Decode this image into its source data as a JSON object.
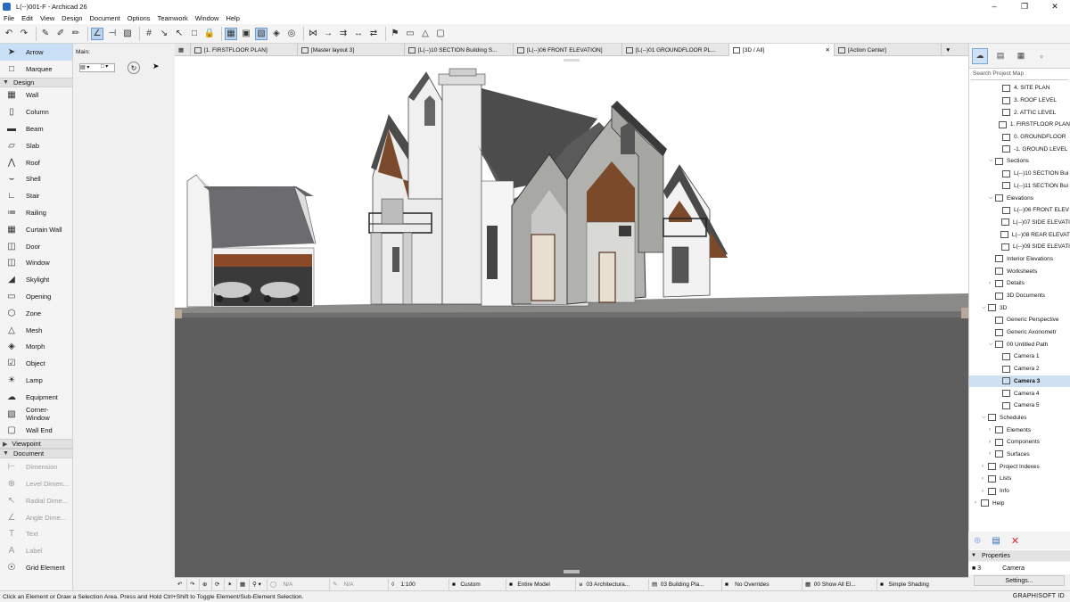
{
  "window": {
    "title": "L(--)001-F - Archicad 26"
  },
  "menu": [
    "File",
    "Edit",
    "View",
    "Design",
    "Document",
    "Options",
    "Teamwork",
    "Window",
    "Help"
  ],
  "toolbox": {
    "arrow": "Arrow",
    "marquee": "Marquee",
    "design_header": "Design",
    "design_tools": [
      "Wall",
      "Column",
      "Beam",
      "Slab",
      "Roof",
      "Shell",
      "Stair",
      "Railing",
      "Curtain Wall",
      "Door",
      "Window",
      "Skylight",
      "Opening",
      "Zone",
      "Mesh",
      "Morph",
      "Object",
      "Lamp",
      "Equipment",
      "Corner-Window",
      "Wall End"
    ],
    "viewpoint_header": "Viewpoint",
    "document_header": "Document",
    "document_tools": [
      "Dimension",
      "Level Dimen...",
      "Radial Dime...",
      "Angle Dime...",
      "Text",
      "Label",
      "Grid Element"
    ]
  },
  "infobox": {
    "main_label": "Main:"
  },
  "tabs": [
    {
      "label": "[1. FIRSTFLOOR PLAN]"
    },
    {
      "label": "[Master layout 3]"
    },
    {
      "label": "[L(--)10 SECTION Building S..."
    },
    {
      "label": "[L(--)06 FRONT ELEVATION]"
    },
    {
      "label": "[L(--)01 GROUNDFLOOR PL..."
    },
    {
      "label": "[3D / All]"
    },
    {
      "label": "[Action Center]"
    }
  ],
  "bottombar": {
    "na1": "N/A",
    "na2": "N/A",
    "scale": "1:100",
    "custom": "Custom",
    "model": "Entire Model",
    "layer": "03 Architectura...",
    "pen": "03 Building Pla...",
    "overrides": "No Overrides",
    "renovation": "00 Show All El...",
    "shading": "Simple Shading"
  },
  "status": "Click an Element or Draw a Selection Area. Press and Hold Ctrl+Shift to Toggle Element/Sub-Element Selection.",
  "navigator": {
    "search_placeholder": "Search Project Map",
    "items": [
      {
        "label": "4. SITE PLAN",
        "indent": 2,
        "sel": false
      },
      {
        "label": "3. ROOF LEVEL",
        "indent": 2,
        "sel": false
      },
      {
        "label": "2. ATTIC LEVEL",
        "indent": 2,
        "sel": false
      },
      {
        "label": "1. FIRSTFLOOR PLAN",
        "indent": 2,
        "sel": false
      },
      {
        "label": "0. GROUNDFLOOR",
        "indent": 2,
        "sel": false
      },
      {
        "label": "-1. GROUND LEVEL",
        "indent": 2,
        "sel": false
      },
      {
        "label": "Sections",
        "indent": 1,
        "sel": false,
        "chev": "v"
      },
      {
        "label": "L(--)10 SECTION Bui",
        "indent": 2,
        "sel": false
      },
      {
        "label": "L(--)11 SECTION Bui",
        "indent": 2,
        "sel": false
      },
      {
        "label": "Elevations",
        "indent": 1,
        "sel": false,
        "chev": "v"
      },
      {
        "label": "L(--)06 FRONT ELEV",
        "indent": 2,
        "sel": false
      },
      {
        "label": "L(--)07 SIDE ELEVATI",
        "indent": 2,
        "sel": false
      },
      {
        "label": "L(--)08 REAR ELEVAT",
        "indent": 2,
        "sel": false
      },
      {
        "label": "L(--)09 SIDE ELEVATI",
        "indent": 2,
        "sel": false
      },
      {
        "label": "Interior Elevations",
        "indent": 1,
        "sel": false
      },
      {
        "label": "Worksheets",
        "indent": 1,
        "sel": false
      },
      {
        "label": "Details",
        "indent": 1,
        "sel": false,
        "chev": ">"
      },
      {
        "label": "3D Documents",
        "indent": 1,
        "sel": false
      },
      {
        "label": "3D",
        "indent": 0,
        "sel": false,
        "chev": "v"
      },
      {
        "label": "Generic Perspective",
        "indent": 1,
        "sel": false
      },
      {
        "label": "Generic Axonometr",
        "indent": 1,
        "sel": false
      },
      {
        "label": "00 Untitled Path",
        "indent": 1,
        "sel": false,
        "chev": "v"
      },
      {
        "label": "Camera 1",
        "indent": 2,
        "sel": false
      },
      {
        "label": "Camera 2",
        "indent": 2,
        "sel": false
      },
      {
        "label": "Camera 3",
        "indent": 2,
        "sel": true
      },
      {
        "label": "Camera 4",
        "indent": 2,
        "sel": false
      },
      {
        "label": "Camera 5",
        "indent": 2,
        "sel": false
      },
      {
        "label": "Schedules",
        "indent": 0,
        "sel": false,
        "chev": "v"
      },
      {
        "label": "Elements",
        "indent": 1,
        "sel": false,
        "chev": ">"
      },
      {
        "label": "Components",
        "indent": 1,
        "sel": false,
        "chev": ">"
      },
      {
        "label": "Surfaces",
        "indent": 1,
        "sel": false,
        "chev": ">"
      },
      {
        "label": "Project Indexes",
        "indent": 0,
        "sel": false,
        "chev": ">"
      },
      {
        "label": "Lists",
        "indent": 0,
        "sel": false,
        "chev": ">"
      },
      {
        "label": "Info",
        "indent": 0,
        "sel": false,
        "chev": ">"
      },
      {
        "label": "Help",
        "indent": -1,
        "sel": false,
        "chev": ">"
      }
    ]
  },
  "properties": {
    "header": "Properties",
    "id": "3",
    "name": "Camera",
    "settings": "Settings..."
  },
  "brand": "GRAPHISOFT ID"
}
